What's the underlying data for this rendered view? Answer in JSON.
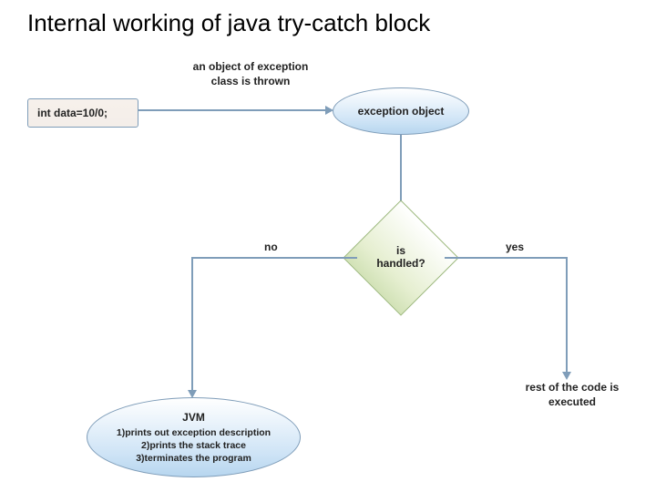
{
  "title": "Internal working of java try-catch block",
  "nodes": {
    "code_box": "int  data=10/0;",
    "thrown_caption": "an object of exception\nclass is thrown",
    "exception_object": "exception object",
    "decision": "is\nhandled?",
    "no_label": "no",
    "yes_label": "yes",
    "jvm": {
      "heading": "JVM",
      "line1": "1)prints out exception description",
      "line2": "2)prints the stack trace",
      "line3": "3)terminates the program"
    },
    "rest_caption": "rest of the code is\nexecuted"
  },
  "chart_data": {
    "type": "flowchart",
    "title": "Internal working of java try-catch block",
    "nodes": [
      {
        "id": "code",
        "type": "process",
        "label": "int data=10/0;"
      },
      {
        "id": "exObj",
        "type": "terminator",
        "label": "exception object"
      },
      {
        "id": "handled",
        "type": "decision",
        "label": "is handled?"
      },
      {
        "id": "jvm",
        "type": "terminator",
        "label": "JVM: 1)prints out exception description 2)prints the stack trace 3)terminates the program"
      },
      {
        "id": "rest",
        "type": "terminator",
        "label": "rest of the code is executed"
      }
    ],
    "edges": [
      {
        "from": "code",
        "to": "exObj",
        "label": "an object of exception class is thrown"
      },
      {
        "from": "exObj",
        "to": "handled",
        "label": ""
      },
      {
        "from": "handled",
        "to": "jvm",
        "label": "no"
      },
      {
        "from": "handled",
        "to": "rest",
        "label": "yes"
      }
    ]
  }
}
